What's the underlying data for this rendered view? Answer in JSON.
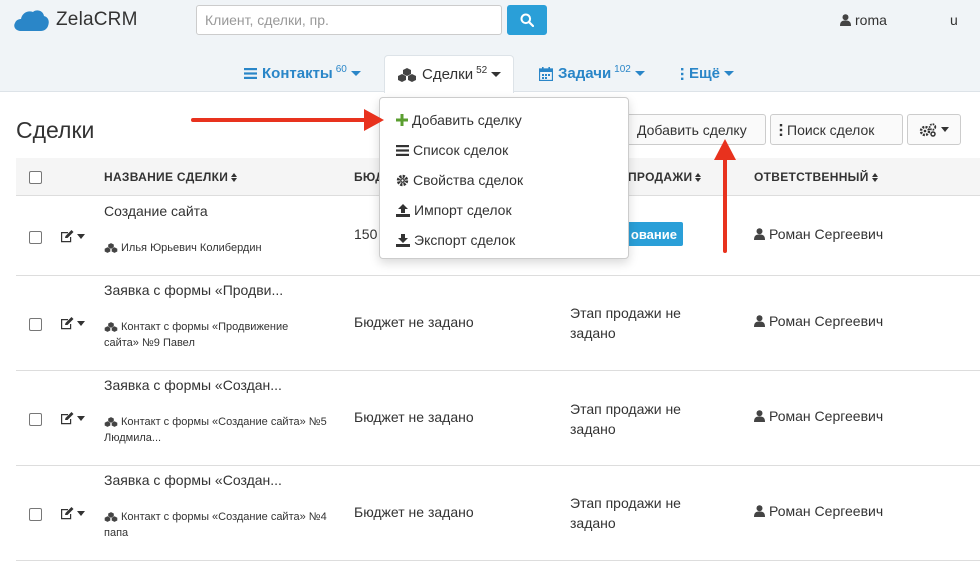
{
  "app": {
    "name": "ZelaCRM",
    "brand_color": "#2a9fd8"
  },
  "search": {
    "placeholder": "Клиент, сделки, пр.",
    "value": ""
  },
  "user": {
    "name": "roma",
    "lang": "u"
  },
  "nav": {
    "items": [
      {
        "label": "Контакты",
        "count": "60",
        "icon": "list-icon"
      },
      {
        "label": "Сделки",
        "count": "52",
        "icon": "cubes-icon",
        "active": true
      },
      {
        "label": "Задачи",
        "count": "102",
        "icon": "calendar-icon"
      },
      {
        "label": "Ещё",
        "count": "",
        "icon": "more-icon"
      }
    ]
  },
  "page": {
    "title": "Сделки",
    "add_button": "Добавить сделку",
    "search_button": "Поиск сделок"
  },
  "dropdown": {
    "items": [
      {
        "label": "Добавить сделку",
        "icon": "plus-icon"
      },
      {
        "label": "Список сделок",
        "icon": "list-icon"
      },
      {
        "label": "Свойства сделок",
        "icon": "gear-icon"
      },
      {
        "label": "Импорт сделок",
        "icon": "upload-icon"
      },
      {
        "label": "Экспорт сделок",
        "icon": "download-icon"
      }
    ]
  },
  "table": {
    "columns": {
      "name": "НАЗВАНИЕ СДЕЛКИ",
      "budget": "БЮД",
      "stage": "ПРОДАЖИ",
      "owner": "ОТВЕТСТВЕННЫЙ"
    },
    "rows": [
      {
        "name": "Создание сайта",
        "contact": "Илья Юрьевич Колибердин",
        "budget": "150",
        "stage": "ование",
        "stage_badge": true,
        "owner": "Роман Сергеевич"
      },
      {
        "name": "Заявка с формы «Продви...",
        "contact": "Контакт с формы «Продвижение сайта» №9 Павел",
        "budget": "Бюджет не задано",
        "stage": "Этап продажи не задано",
        "owner": "Роман Сергеевич"
      },
      {
        "name": "Заявка с формы «Создан...",
        "contact": "Контакт с формы «Создание сайта» №5 Людмила...",
        "budget": "Бюджет не задано",
        "stage": "Этап продажи не задано",
        "owner": "Роман Сергеевич"
      },
      {
        "name": "Заявка с формы «Создан...",
        "contact": "Контакт с формы «Создание сайта» №4 папа",
        "budget": "Бюджет не задано",
        "stage": "Этап продажи не задано",
        "owner": "Роман Сергеевич"
      }
    ]
  },
  "annotation_color": "#e8321e"
}
